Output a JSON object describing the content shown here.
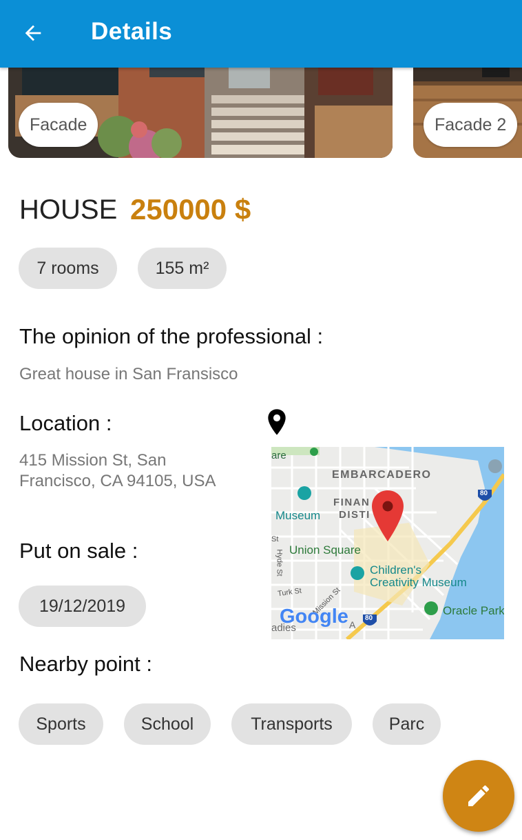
{
  "appbar": {
    "title": "Details",
    "back_icon": "arrow-back-icon",
    "color": "#0b8fd6"
  },
  "photos": [
    {
      "caption": "Facade"
    },
    {
      "caption": "Facade 2"
    }
  ],
  "property": {
    "type": "HOUSE",
    "price": "250000 $",
    "price_color": "#c9800e"
  },
  "specs": {
    "rooms": "7 rooms",
    "area": "155 m²"
  },
  "opinion": {
    "title": "The opinion of the professional :",
    "text": "Great house in San Fransisco"
  },
  "location": {
    "title": "Location :",
    "address_line1": "415 Mission St, San",
    "address_line2": "Francisco, CA 94105, USA",
    "map_labels": {
      "embarcadero": "EMBARCADERO",
      "financial": "FINAN",
      "district": "DISTI",
      "museum": "Museum",
      "union_square": "Union Square",
      "childrens_1": "Children's",
      "childrens_2": "Creativity Museum",
      "oracle": "Oracle Park",
      "hyde": "Hyde St",
      "turk": "Turk St",
      "mission": "Mission St",
      "are": "are",
      "st": "St",
      "adies": "adies",
      "a": "A",
      "hwy_80_a": "80",
      "hwy_80_b": "80",
      "google": "Google"
    }
  },
  "sale": {
    "title": "Put on sale :",
    "date": "19/12/2019"
  },
  "nearby": {
    "title": "Nearby point :",
    "items": [
      "Sports",
      "School",
      "Transports",
      "Parc"
    ]
  },
  "fab": {
    "icon": "edit-pencil-icon",
    "color": "#cf8514"
  }
}
